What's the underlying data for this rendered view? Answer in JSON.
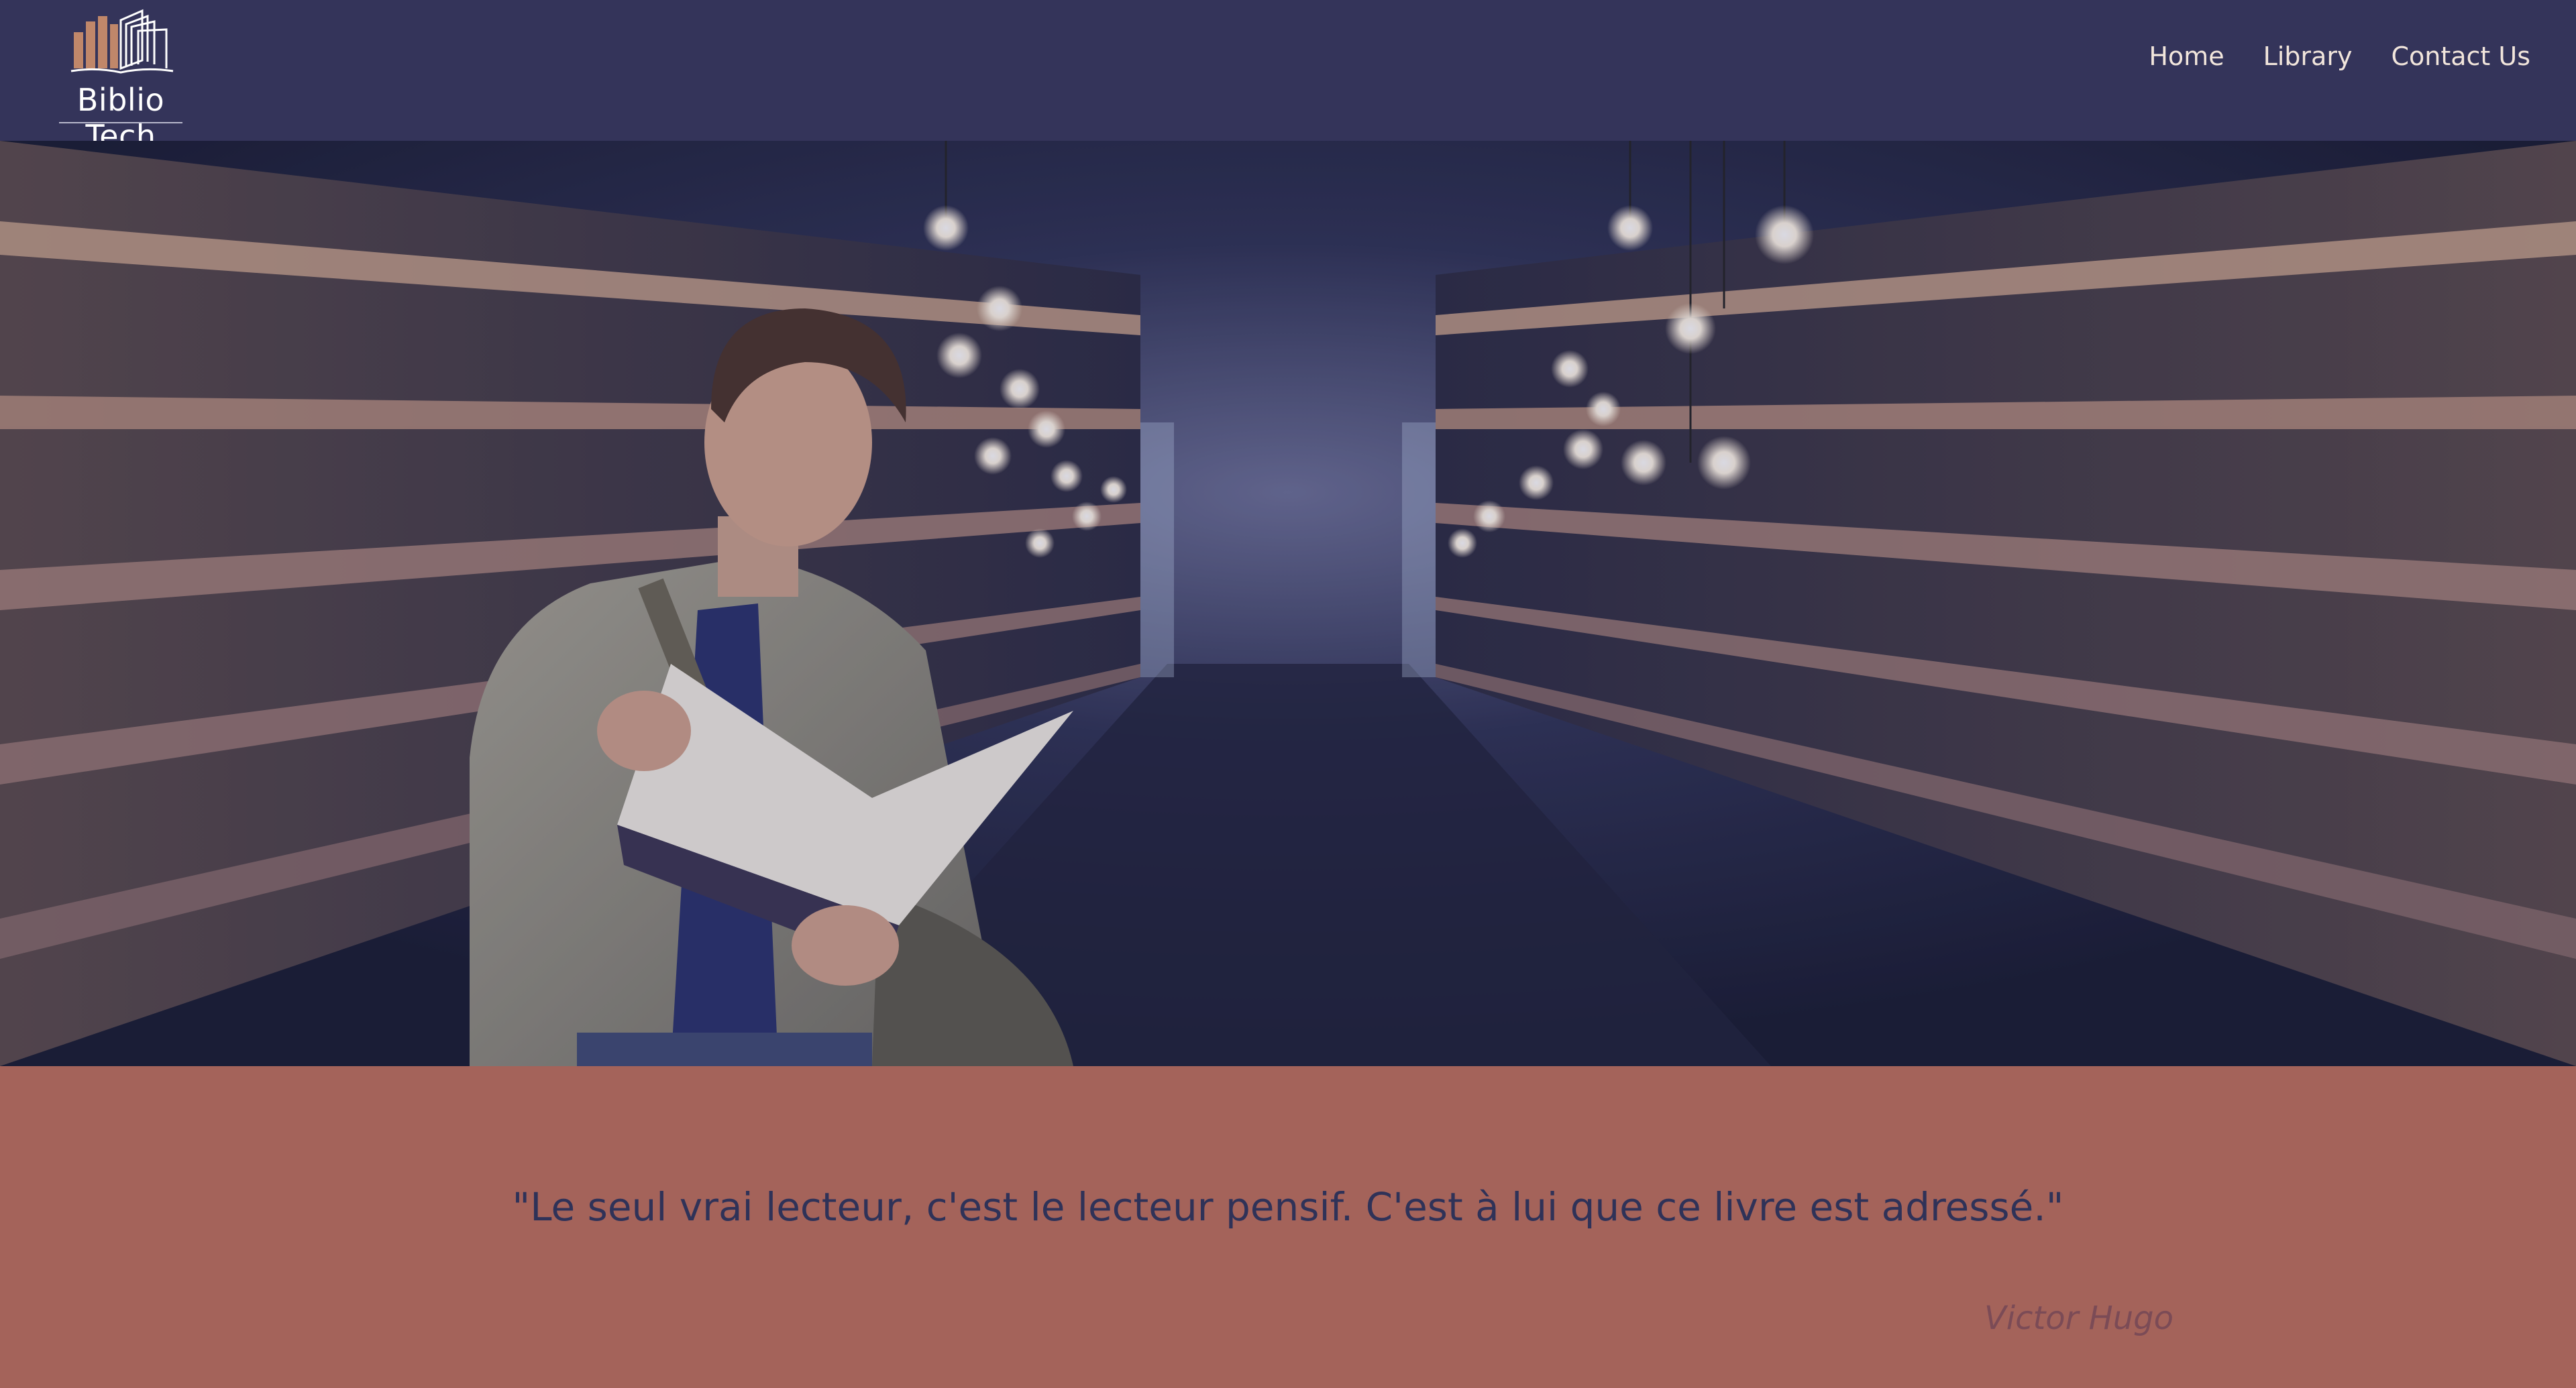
{
  "header": {
    "logo_text": "Biblio Tech",
    "logo_icon": "open-book-with-bars-icon",
    "bg_color": "#34345a"
  },
  "nav": {
    "items": [
      {
        "label": "Home"
      },
      {
        "label": "Library"
      },
      {
        "label": "Contact Us"
      }
    ],
    "text_color": "#f2e6dc"
  },
  "hero": {
    "image": "student-reading-book-in-library-aisle"
  },
  "quote": {
    "text": "\"Le seul vrai lecteur, c'est le lecteur pensif. C'est à lui que ce livre est adressé.\"",
    "author": "Victor Hugo",
    "bg_color": "#a4635a",
    "text_color": "#2f3258"
  }
}
